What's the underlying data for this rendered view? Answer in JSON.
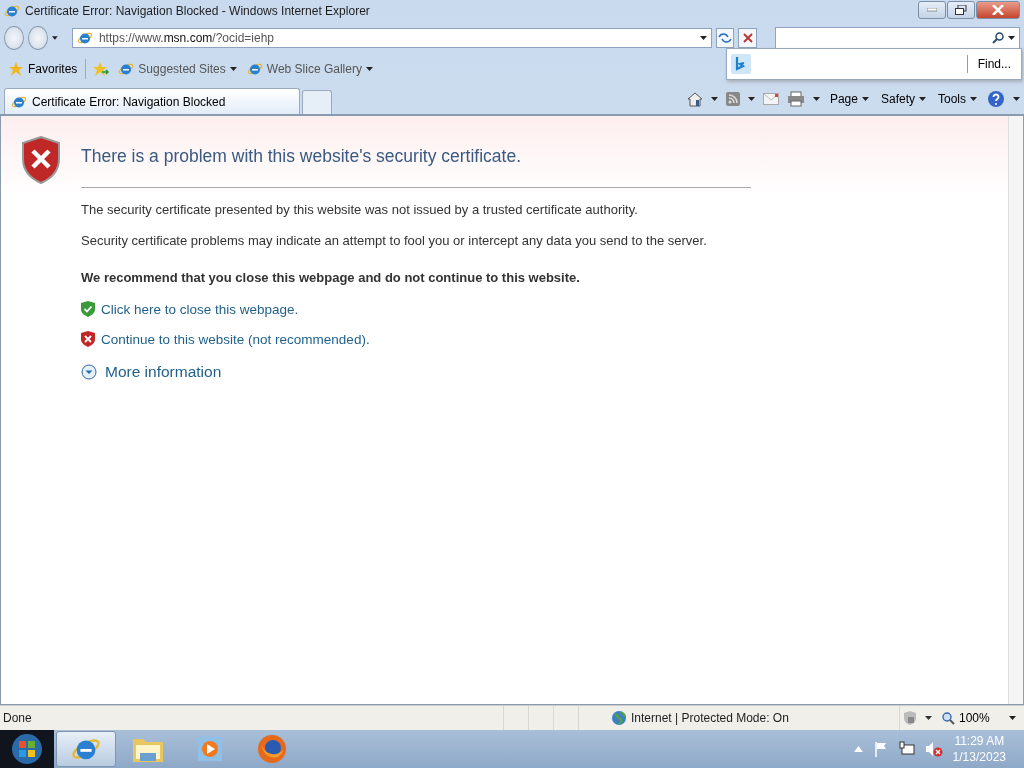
{
  "window": {
    "title": "Certificate Error: Navigation Blocked - Windows Internet Explorer"
  },
  "address_bar": {
    "url": "https://www.**msn.com**/?ocid=iehp"
  },
  "search_dropdown": {
    "find_label": "Find..."
  },
  "favorites_bar": {
    "favorites_label": "Favorites",
    "items": [
      "Suggested Sites",
      "Web Slice Gallery"
    ]
  },
  "tabs": [
    {
      "label": "Certificate Error: Navigation Blocked",
      "selected": true
    }
  ],
  "command_bar": {
    "menus": [
      "Page",
      "Safety",
      "Tools"
    ]
  },
  "page": {
    "heading": "There is a problem with this website's security certificate.",
    "paragraphs": [
      "The security certificate presented by this website was not issued by a trusted certificate authority.",
      "Security certificate problems may indicate an attempt to fool you or intercept any data you send to the server."
    ],
    "recommendation": "We recommend that you close this webpage and do not continue to this website.",
    "links": [
      {
        "kind": "safe",
        "text": "Click here to close this webpage."
      },
      {
        "kind": "unsafe",
        "text": "Continue to this website (not recommended)."
      }
    ],
    "more_info": "More information"
  },
  "status_bar": {
    "status": "Done",
    "zone": "Internet | Protected Mode: On",
    "zoom": "100%"
  },
  "taskbar": {
    "apps": [
      {
        "kind": "ie",
        "selected": true
      },
      {
        "kind": "folder",
        "selected": false
      },
      {
        "kind": "media",
        "selected": false
      },
      {
        "kind": "firefox",
        "selected": false
      }
    ],
    "time": "11:29 AM",
    "date": "1/13/2023"
  }
}
